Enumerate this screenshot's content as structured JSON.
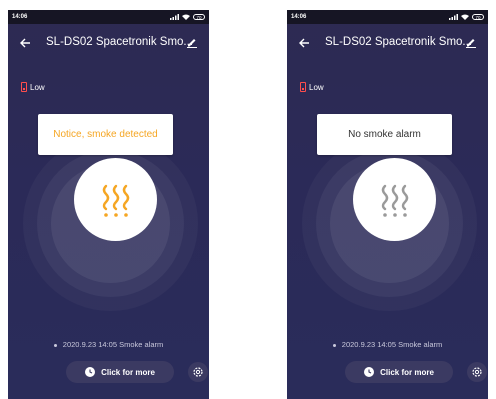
{
  "colors": {
    "alert_text": "#f5a623",
    "normal_text": "#333333",
    "alert_icon": "#f5a623",
    "normal_icon": "#9a9a9a"
  },
  "screens": [
    {
      "status": {
        "time": "14:06",
        "battery": "70"
      },
      "header": {
        "title": "SL-DS02 Spacetronik Smo..."
      },
      "battery_state": "Low",
      "notice": "Notice, smoke detected",
      "state": "alert",
      "last_event": "2020.9.23 14:05 Smoke alarm",
      "more_button": "Click for more"
    },
    {
      "status": {
        "time": "14:06",
        "battery": "70"
      },
      "header": {
        "title": "SL-DS02 Spacetronik Smo..."
      },
      "battery_state": "Low",
      "notice": "No smoke alarm",
      "state": "normal",
      "last_event": "2020.9.23 14:05 Smoke alarm",
      "more_button": "Click for more"
    }
  ]
}
